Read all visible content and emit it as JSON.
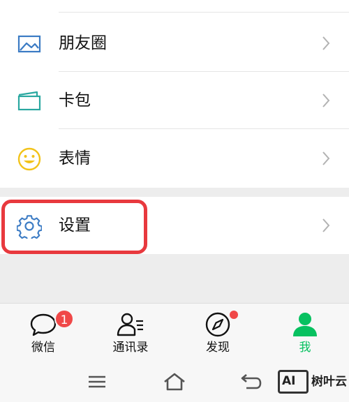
{
  "menu": {
    "items": [
      {
        "label": "朋友圈",
        "icon": "moments-picture-icon"
      },
      {
        "label": "卡包",
        "icon": "card-wallet-icon"
      },
      {
        "label": "表情",
        "icon": "smiley-face-icon"
      }
    ],
    "settings": {
      "label": "设置",
      "icon": "gear-icon",
      "highlighted": true
    }
  },
  "tabbar": {
    "tabs": [
      {
        "label": "微信",
        "icon": "chat-bubble-icon",
        "badge": "1"
      },
      {
        "label": "通讯录",
        "icon": "contacts-icon"
      },
      {
        "label": "发现",
        "icon": "compass-icon",
        "dot": true
      },
      {
        "label": "我",
        "icon": "person-icon",
        "active": true
      }
    ]
  },
  "navbar": {
    "buttons": [
      "menu-icon",
      "home-icon",
      "back-icon"
    ]
  },
  "watermark": {
    "logo": "AI",
    "text": "树叶云"
  },
  "colors": {
    "active_green": "#07c160",
    "highlight_red": "#e8393e",
    "badge_red": "#f04848",
    "icon_blue": "#3b7bc4"
  }
}
